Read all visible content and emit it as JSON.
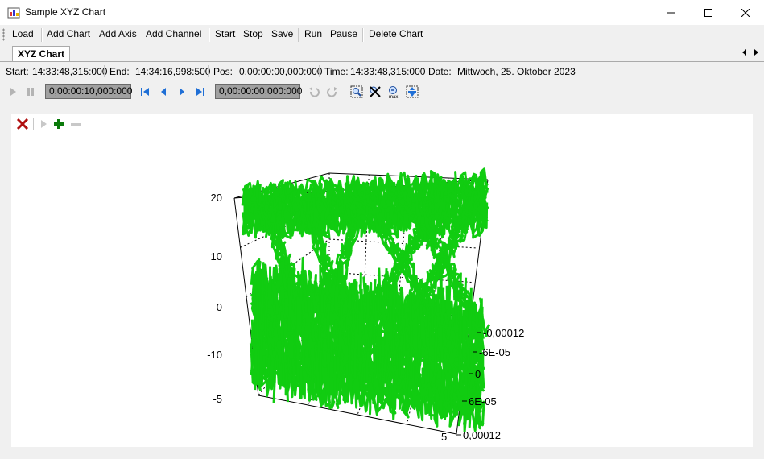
{
  "window": {
    "title": "Sample XYZ Chart"
  },
  "menu": {
    "items": [
      "Load",
      "Add Chart",
      "Add Axis",
      "Add Channel",
      "Start",
      "Stop",
      "Save",
      "Run",
      "Pause",
      "Delete Chart"
    ]
  },
  "tabs": [
    {
      "label": "XYZ Chart",
      "selected": true
    }
  ],
  "info": {
    "start_label": "Start:",
    "start_value": "14:33:48,315:000",
    "end_label": "End:",
    "end_value": "14:34:16,998:500",
    "pos_label": "Pos:",
    "pos_value": "0,00:00:00,000:000",
    "time_label": "Time:",
    "time_value": "14:33:48,315:000",
    "date_label": "Date:",
    "date_value": "Mittwoch, 25. Oktober 2023"
  },
  "playback": {
    "interval_value": "0,00:00:10,000:000",
    "position_value": "0,00:00:00,000:000"
  },
  "chart_data": {
    "type": "scatter",
    "title": "",
    "series": [
      {
        "color": "#11cc11"
      }
    ],
    "y_axis_ticks": [
      "20",
      "10",
      "0",
      "-10",
      "-5"
    ],
    "depth_axis_ticks": [
      "-0,00012",
      "-6E-05",
      "0",
      "6E-05",
      "0,00012"
    ],
    "x_axis_ticks": [
      "5"
    ],
    "grid": true
  },
  "colors": {
    "series_green": "#11cc11",
    "delete_red": "#b01010",
    "add_green": "#0a7a0a"
  }
}
